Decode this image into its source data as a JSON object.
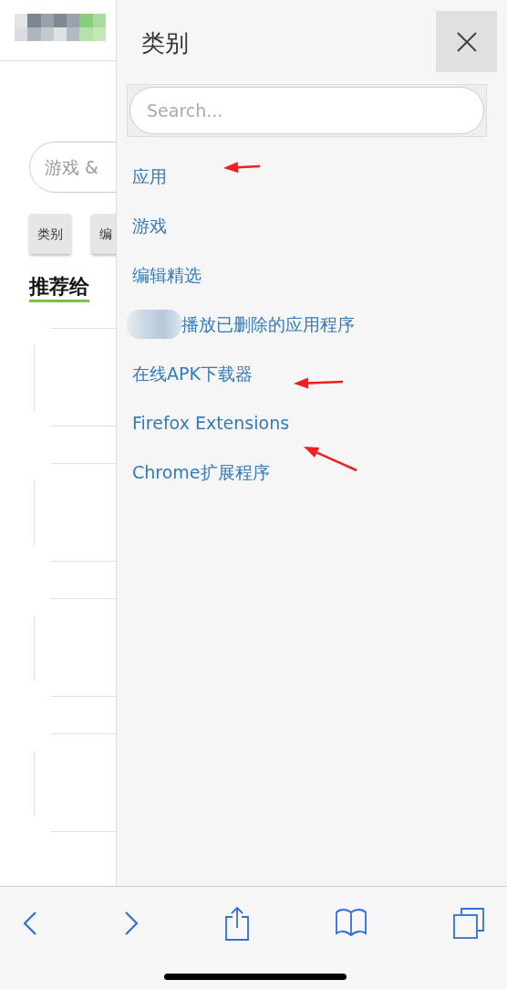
{
  "page": {
    "search": {
      "placeholder": "游戏 &"
    },
    "buttons": [
      "类别",
      "编"
    ],
    "heading": "推荐给"
  },
  "panel": {
    "title": "类别",
    "search": {
      "placeholder": "Search..."
    },
    "items": [
      {
        "label": "应用",
        "blurred": false
      },
      {
        "label": "游戏",
        "blurred": false
      },
      {
        "label": "编辑精选",
        "blurred": false
      },
      {
        "label": "播放已删除的应用程序",
        "blurred": true
      },
      {
        "label": "在线APK下载器",
        "blurred": false
      },
      {
        "label": "Firefox Extensions",
        "blurred": false
      },
      {
        "label": "Chrome扩展程序",
        "blurred": false
      }
    ]
  }
}
